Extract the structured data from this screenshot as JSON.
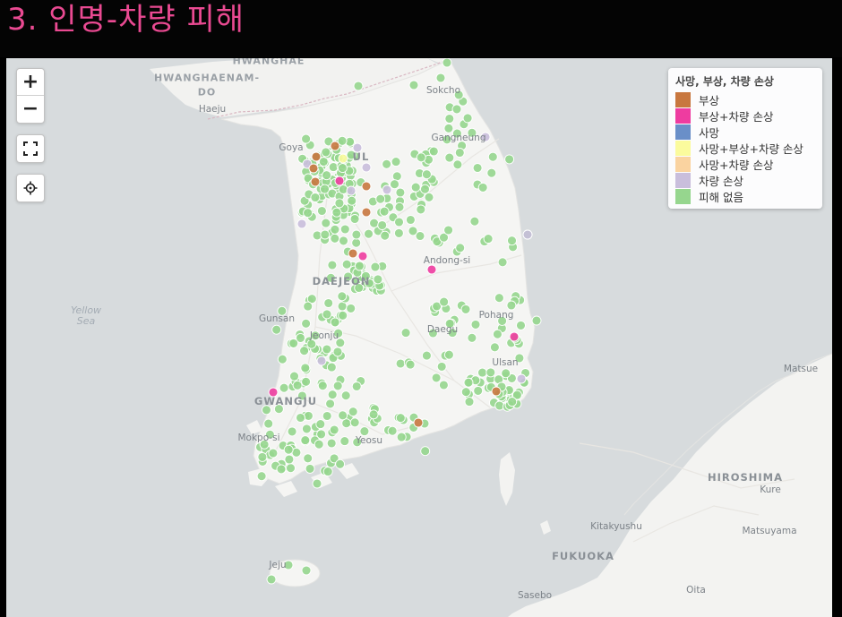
{
  "header": {
    "title": "3.  인명-차량  피해"
  },
  "map": {
    "controls": {
      "zoom_in_label": "+",
      "zoom_out_label": "−",
      "fullscreen_icon": "fullscreen-icon",
      "locate_icon": "locate-icon"
    },
    "legend": {
      "title": "사망, 부상, 차량 손상",
      "items": [
        {
          "label": "부상",
          "color": "#c8773f"
        },
        {
          "label": "부상+차량 손상",
          "color": "#ee3ca0"
        },
        {
          "label": "사망",
          "color": "#6a8fc8"
        },
        {
          "label": "사망+부상+차량 손상",
          "color": "#fbfb9d"
        },
        {
          "label": "사망+차량 손상",
          "color": "#fad3a0"
        },
        {
          "label": "차량 손상",
          "color": "#c9bedc"
        },
        {
          "label": "피해 없음",
          "color": "#96d68e"
        }
      ]
    },
    "place_labels": [
      {
        "text": "HWANGHAE",
        "kind": "region"
      },
      {
        "text": "HWANGHAENAM-",
        "kind": "region"
      },
      {
        "text": "DO",
        "kind": "region"
      },
      {
        "text": "Haeju",
        "kind": "city"
      },
      {
        "text": "Sokcho",
        "kind": "city"
      },
      {
        "text": "Gangneung",
        "kind": "city"
      },
      {
        "text": "Goya",
        "kind": "city"
      },
      {
        "text": "UL",
        "kind": "bigcity"
      },
      {
        "text": "Andong-si",
        "kind": "city"
      },
      {
        "text": "DAEJEON",
        "kind": "bigcity"
      },
      {
        "text": "Yellow",
        "kind": "sea"
      },
      {
        "text": "Sea",
        "kind": "sea"
      },
      {
        "text": "Gunsan",
        "kind": "city"
      },
      {
        "text": "Jeonju",
        "kind": "city"
      },
      {
        "text": "Pohang",
        "kind": "city"
      },
      {
        "text": "Daegu",
        "kind": "city"
      },
      {
        "text": "Ulsan",
        "kind": "city"
      },
      {
        "text": "GWANGJU",
        "kind": "bigcity"
      },
      {
        "text": "Mokpo-si",
        "kind": "city"
      },
      {
        "text": "Yeosu",
        "kind": "city"
      },
      {
        "text": "Matsue",
        "kind": "city"
      },
      {
        "text": "HIROSHIMA",
        "kind": "bigcity"
      },
      {
        "text": "Kure",
        "kind": "city"
      },
      {
        "text": "Kitakyushu",
        "kind": "city"
      },
      {
        "text": "Matsuyama",
        "kind": "city"
      },
      {
        "text": "FUKUOKA",
        "kind": "bigcity"
      },
      {
        "text": "Jeju",
        "kind": "city"
      },
      {
        "text": "Sasebo",
        "kind": "city"
      },
      {
        "text": "Oita",
        "kind": "city"
      }
    ]
  }
}
